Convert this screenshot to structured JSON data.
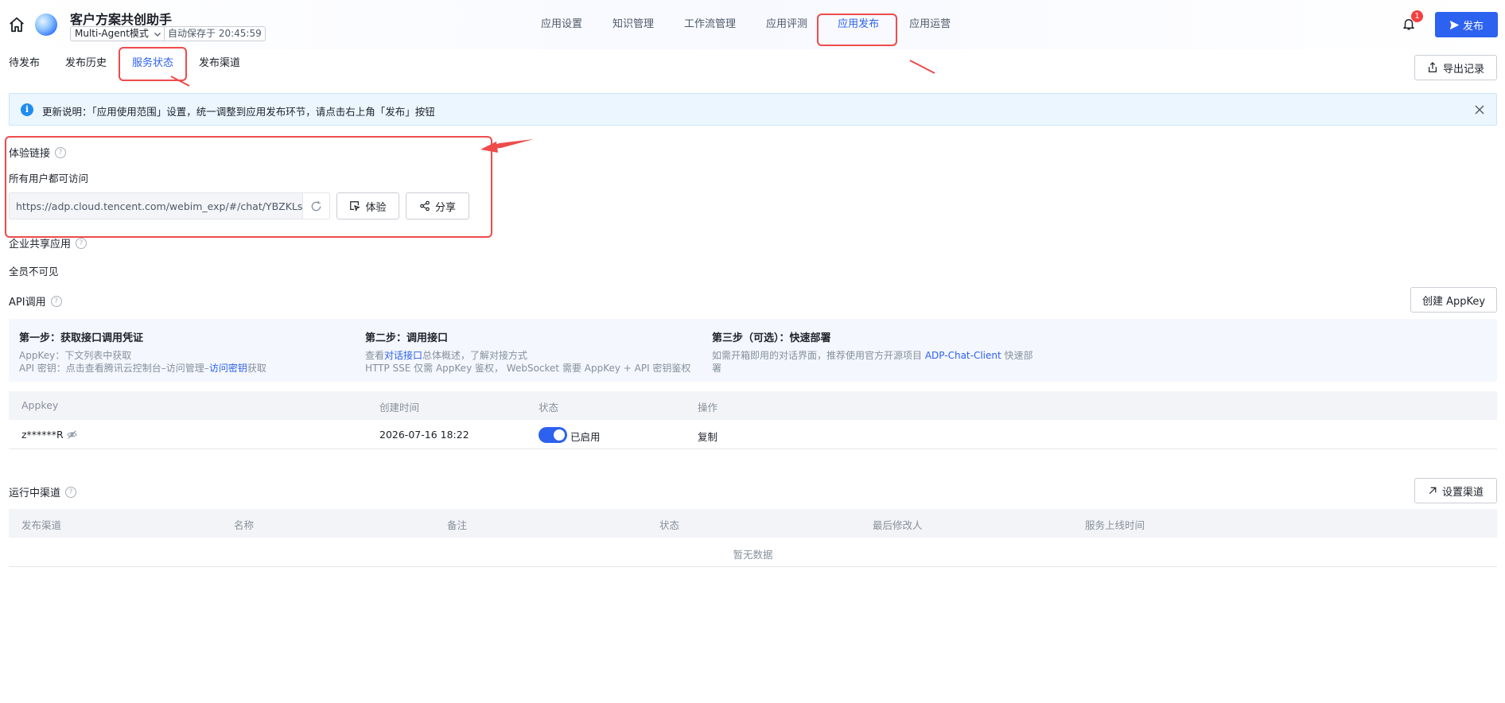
{
  "header": {
    "title": "客户方案共创助手",
    "mode": "Multi-Agent模式",
    "autosave": "自动保存于 20:45:59",
    "nav": [
      "应用设置",
      "知识管理",
      "工作流管理",
      "应用评测",
      "应用发布",
      "应用运营"
    ],
    "active_nav": "应用发布",
    "notification_count": "1",
    "publish_label": "发布"
  },
  "sub_tabs": {
    "items": [
      "待发布",
      "发布历史",
      "服务状态",
      "发布渠道"
    ],
    "active": "服务状态",
    "export_label": "导出记录"
  },
  "notice": {
    "text": "更新说明：「应用使用范围」设置，统一调整到应用发布环节，请点击右上角「发布」按钮"
  },
  "experience": {
    "title": "体验链接",
    "access": "所有用户都可访问",
    "url": "https://adp.cloud.tencent.com/webim_exp/#/chat/YBZKLs",
    "try_label": "体验",
    "share_label": "分享"
  },
  "enterprise": {
    "title": "企业共享应用",
    "visibility": "全员不可见"
  },
  "api": {
    "title": "API调用",
    "create_label": "创建 AppKey",
    "steps": [
      {
        "title": "第一步：获取接口调用凭证",
        "line1": "AppKey：下文列表中获取",
        "line2_prefix": "API 密钥：点击查看腾讯云控制台–访问管理–",
        "line2_link": "访问密钥",
        "line2_suffix": "获取"
      },
      {
        "title": "第二步：调用接口",
        "line1_prefix": "查看",
        "line1_link": "对话接口",
        "line1_suffix": "总体概述，了解对接方式",
        "line2": "HTTP SSE 仅需 AppKey 鉴权， WebSocket 需要 AppKey + API 密钥鉴权"
      },
      {
        "title": "第三步（可选）：快速部署",
        "line1_prefix": "如需开箱即用的对话界面，推荐使用官方开源项目 ",
        "line1_link": "ADP-Chat-Client",
        "line1_suffix": " 快速部",
        "line2": "署"
      }
    ],
    "columns": [
      "Appkey",
      "创建时间",
      "状态",
      "操作"
    ],
    "rows": [
      {
        "appkey": "z******R",
        "created": "2026-07-16 18:22",
        "status": "已启用",
        "action": "复制",
        "enabled": true
      }
    ]
  },
  "channels": {
    "title": "运行中渠道",
    "setup_label": "设置渠道",
    "columns": [
      "发布渠道",
      "名称",
      "备注",
      "状态",
      "最后修改人",
      "服务上线时间"
    ],
    "empty": "暂无数据"
  },
  "colors": {
    "accent": "#2d61f0",
    "annotation": "#ef4b4b"
  }
}
